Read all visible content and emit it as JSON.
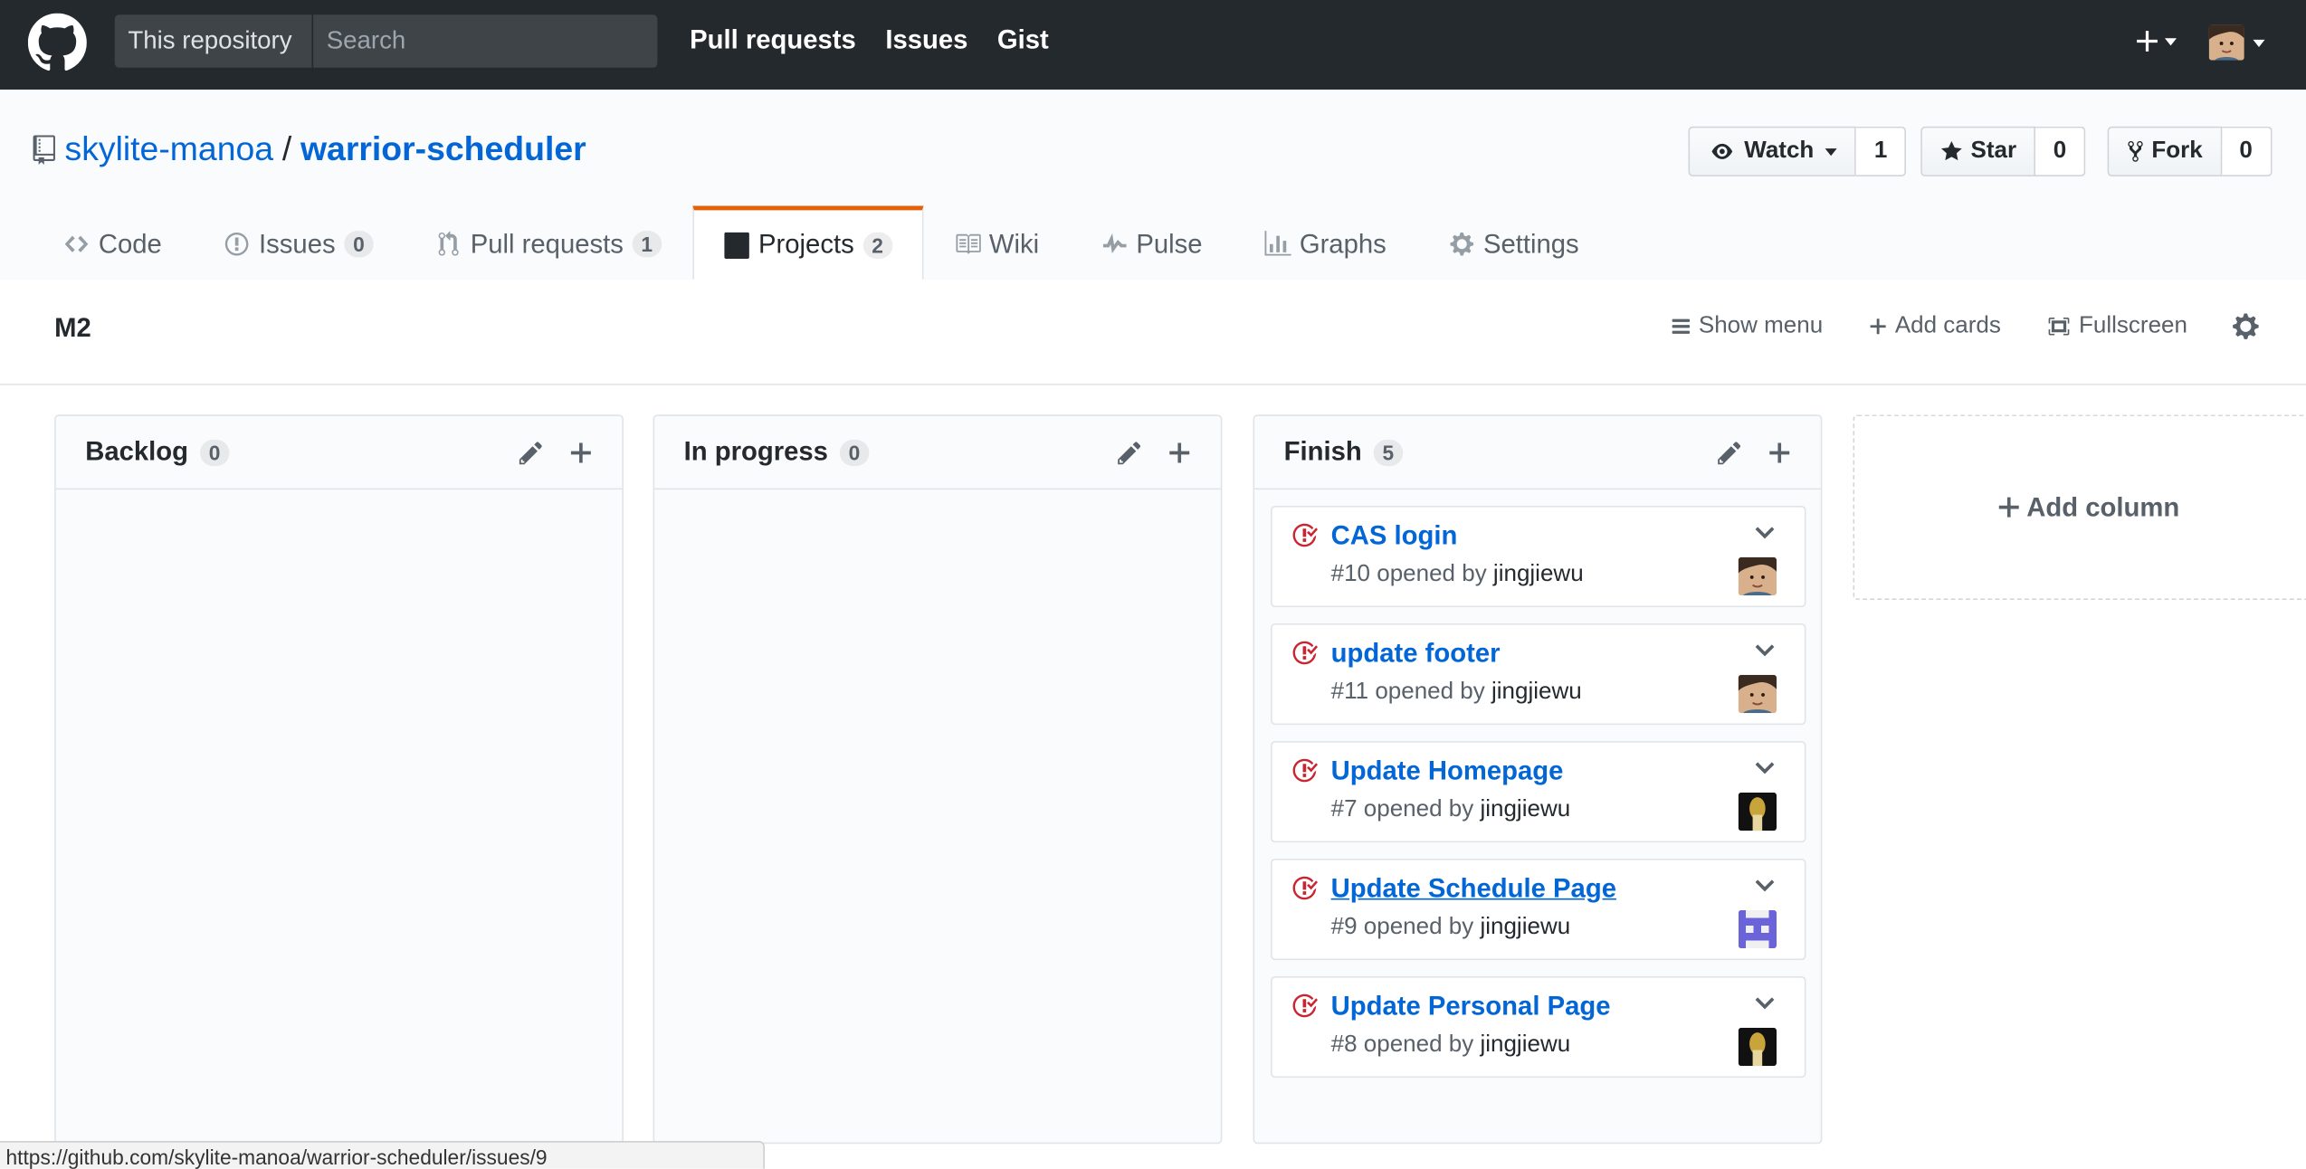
{
  "header": {
    "scope_label": "This repository",
    "search_placeholder": "Search",
    "nav": [
      "Pull requests",
      "Issues",
      "Gist"
    ]
  },
  "repo": {
    "owner": "skylite-manoa",
    "separator": "/",
    "name": "warrior-scheduler",
    "watch": {
      "label": "Watch",
      "count": "1"
    },
    "star": {
      "label": "Star",
      "count": "0"
    },
    "fork": {
      "label": "Fork",
      "count": "0"
    }
  },
  "tabs": [
    {
      "label": "Code",
      "icon": "code-icon",
      "counter": null
    },
    {
      "label": "Issues",
      "icon": "issue-opened-icon",
      "counter": "0"
    },
    {
      "label": "Pull requests",
      "icon": "git-pull-request-icon",
      "counter": "1"
    },
    {
      "label": "Projects",
      "icon": "project-icon",
      "counter": "2",
      "selected": true
    },
    {
      "label": "Wiki",
      "icon": "book-icon",
      "counter": null
    },
    {
      "label": "Pulse",
      "icon": "pulse-icon",
      "counter": null
    },
    {
      "label": "Graphs",
      "icon": "graph-icon",
      "counter": null
    },
    {
      "label": "Settings",
      "icon": "gear-icon",
      "counter": null
    }
  ],
  "project": {
    "name": "M2",
    "show_menu": "Show menu",
    "add_cards": "Add cards",
    "fullscreen": "Fullscreen"
  },
  "columns": [
    {
      "name": "Backlog",
      "count": "0",
      "cards": []
    },
    {
      "name": "In progress",
      "count": "0",
      "cards": []
    },
    {
      "name": "Finish",
      "count": "5",
      "cards": [
        {
          "title": "CAS login",
          "number": "#10",
          "opened_by": "opened by",
          "author": "jingjiewu",
          "avatar": "avatar-photo"
        },
        {
          "title": "update footer",
          "number": "#11",
          "opened_by": "opened by",
          "author": "jingjiewu",
          "avatar": "avatar-photo"
        },
        {
          "title": "Update Homepage",
          "number": "#7",
          "opened_by": "opened by",
          "author": "jingjiewu",
          "avatar": "avatar-dark"
        },
        {
          "title": "Update Schedule Page",
          "number": "#9",
          "opened_by": "opened by",
          "author": "jingjiewu",
          "avatar": "avatar-identicon",
          "hovered": true
        },
        {
          "title": "Update Personal Page",
          "number": "#8",
          "opened_by": "opened by",
          "author": "jingjiewu",
          "avatar": "avatar-dark"
        }
      ]
    }
  ],
  "add_column": "Add column",
  "status_bar_url": "https://github.com/skylite-manoa/warrior-scheduler/issues/9",
  "colors": {
    "header_bg": "#24292e",
    "link_blue": "#0366d6",
    "selected_tab_accent": "#e36209",
    "issue_closed_red": "#cb2431"
  }
}
